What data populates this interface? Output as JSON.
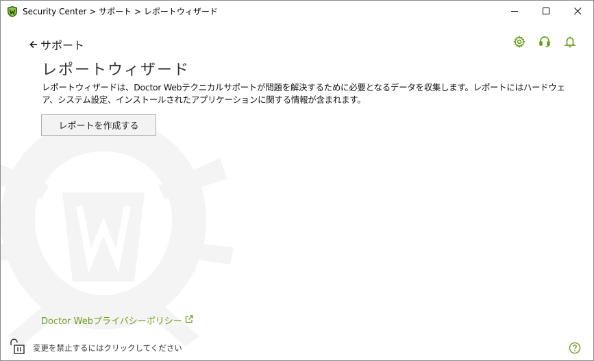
{
  "window": {
    "title": "Security Center > サポート > レポートウィザード"
  },
  "header": {
    "back_label": "サポート",
    "icons": [
      "gear-icon",
      "headset-icon",
      "bell-icon"
    ]
  },
  "main": {
    "title": "レポートウィザード",
    "description": "レポートウィザードは、Doctor Webテクニカルサポートが問題を解決するために必要となるデータを収集します。レポートにはハードウェア、システム設定、インストールされたアプリケーションに関する情報が含まれます。",
    "create_button_label": "レポートを作成する",
    "privacy_link": "Doctor Webプライバシーポリシー"
  },
  "footer": {
    "lock_text": "変更を禁止するにはクリックしてください"
  },
  "colors": {
    "accent": "#6a9f1a",
    "title_text": "#333333",
    "button_bg": "#f3f3f3",
    "button_border": "#adadad"
  }
}
